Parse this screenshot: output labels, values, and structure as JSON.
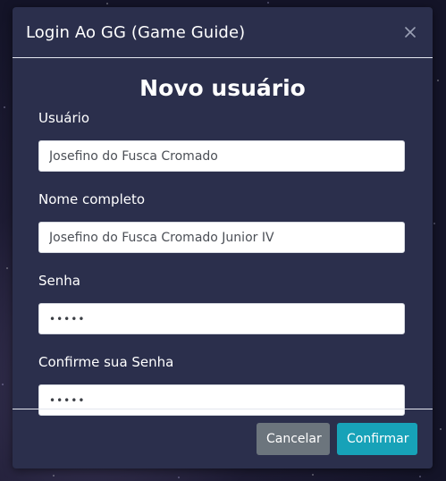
{
  "modal": {
    "title": "Login Ao GG (Game Guide)",
    "close_icon": "close-icon"
  },
  "form": {
    "heading": "Novo usuário",
    "fields": [
      {
        "label": "Usuário",
        "value": "Josefino do Fusca Cromado",
        "type": "text"
      },
      {
        "label": "Nome completo",
        "value": "Josefino do Fusca Cromado Junior IV",
        "type": "text"
      },
      {
        "label": "Senha",
        "value": "•••••",
        "type": "password"
      },
      {
        "label": "Confirme sua Senha",
        "value": "•••••",
        "type": "password"
      }
    ]
  },
  "footer": {
    "cancel_label": "Cancelar",
    "confirm_label": "Confirmar"
  },
  "colors": {
    "modal_bg": "#2b2f4c",
    "cancel_button": "#6c757d",
    "confirm_button": "#17a2b8"
  }
}
